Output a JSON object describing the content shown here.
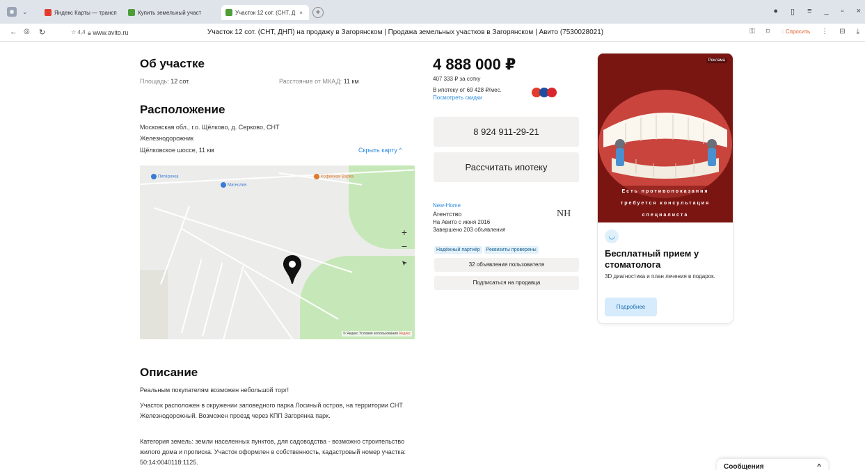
{
  "browser": {
    "tabs": [
      {
        "label": "Яндекс Карты — транспо",
        "color": "#e33b2e"
      },
      {
        "label": "Купить земельный участ",
        "color": "#4c9f38"
      },
      {
        "label": "Участок 12 сот. (СНТ, Д",
        "color": "#4c9f38"
      }
    ],
    "new_tab": "+",
    "rating": "☆ 4,4",
    "url": "www.avito.ru",
    "page_title": "Участок 12 сот. (СНТ, ДНП) на продажу в Загорянском | Продажа земельных участков в Загорянском | Авито (7530028021)",
    "ask_label": "Спросить",
    "accent": "#e05a2a"
  },
  "about": {
    "title": "Об участке",
    "area_label": "Площадь:",
    "area_value": "12 сот.",
    "distance_label": "Расстояние от МКАД:",
    "distance_value": "11 км"
  },
  "location": {
    "title": "Расположение",
    "address_line1": "Московская обл., г.о. Щёлково, д. Серково, СНТ",
    "address_line2": "Железнодорожник",
    "highway": "Щёлковское шоссе, 11 км",
    "hide_map": "Скрыть карту ^"
  },
  "map": {
    "pois": [
      "Пятёрочка",
      "Магнолия",
      "Кофейная Варка"
    ],
    "zoom_in": "+",
    "zoom_out": "−",
    "locate": "➤",
    "footer": "© Яндекс Условия использования",
    "brand": "Яндекс",
    "colors": {
      "green": "#c6e8b8",
      "base": "#ececea",
      "road": "#ffffff"
    }
  },
  "description": {
    "title": "Описание",
    "paragraphs": [
      "Реальным покупателям возможен небольшой торг!",
      "Участок расположен в окружении заповедного парка Лосиный остров, на территории СНТ Железнодорожный. Возможен проезд через КПП Загорянка парк.",
      "Категория земель: земли населенных пунктов, для садоводства - возможно строительство жилого дома и прописка. Участок оформлен в собственность, кадастровый номер участка: 50:14:0040118:1125."
    ]
  },
  "offer": {
    "price": "4 888 000 ₽",
    "price_per_unit": "407 333 ₽ за сотку",
    "mortgage_text": "В ипотеку от 69 428 ₽/мес.",
    "mortgage_link": "Посмотреть скидки",
    "phone": "8 924 911-29-21",
    "calc_mortgage": "Рассчитать ипотеку"
  },
  "seller": {
    "name": "New-Home",
    "type": "Агентство",
    "since": "На Авито с июня 2016",
    "completed": "Завершено 203 объявления",
    "badges": [
      "Надёжный партнёр",
      "Реквизиты проверены"
    ],
    "listings_btn": "32 объявления пользователя",
    "subscribe_btn": "Подписаться на продавца",
    "logo": "NH"
  },
  "ad": {
    "marker": "Реклама",
    "overlay_lines": [
      "Есть противопоказания",
      "требуется консультация",
      "специалиста"
    ],
    "title": "Бесплатный прием у стоматолога",
    "text": "3D диагностика и план лечения в подарок.",
    "button": "Подробнее"
  },
  "messages": {
    "label": "Сообщения",
    "toggle": "^"
  }
}
